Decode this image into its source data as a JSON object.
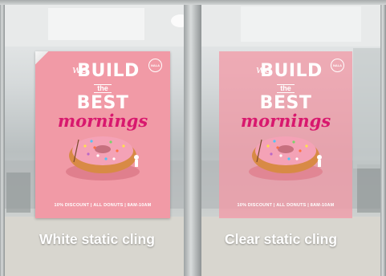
{
  "colors": {
    "poster_pink": "#f19aa6",
    "headline_magenta": "#d8186e",
    "text_white": "#ffffff"
  },
  "posters": [
    {
      "logo": "NALA",
      "we": "we",
      "build": "BUILD",
      "the": "the",
      "best": "BEST",
      "mornings": "mornings",
      "discount": "10% DISCOUNT | ALL DONUTS | 8AM-10AM",
      "caption": "White static cling"
    },
    {
      "logo": "NALA",
      "we": "we",
      "build": "BUILD",
      "the": "the",
      "best": "BEST",
      "mornings": "mornings",
      "discount": "10% DISCOUNT | ALL DONUTS | 8AM-10AM",
      "caption": "Clear static cling"
    }
  ]
}
